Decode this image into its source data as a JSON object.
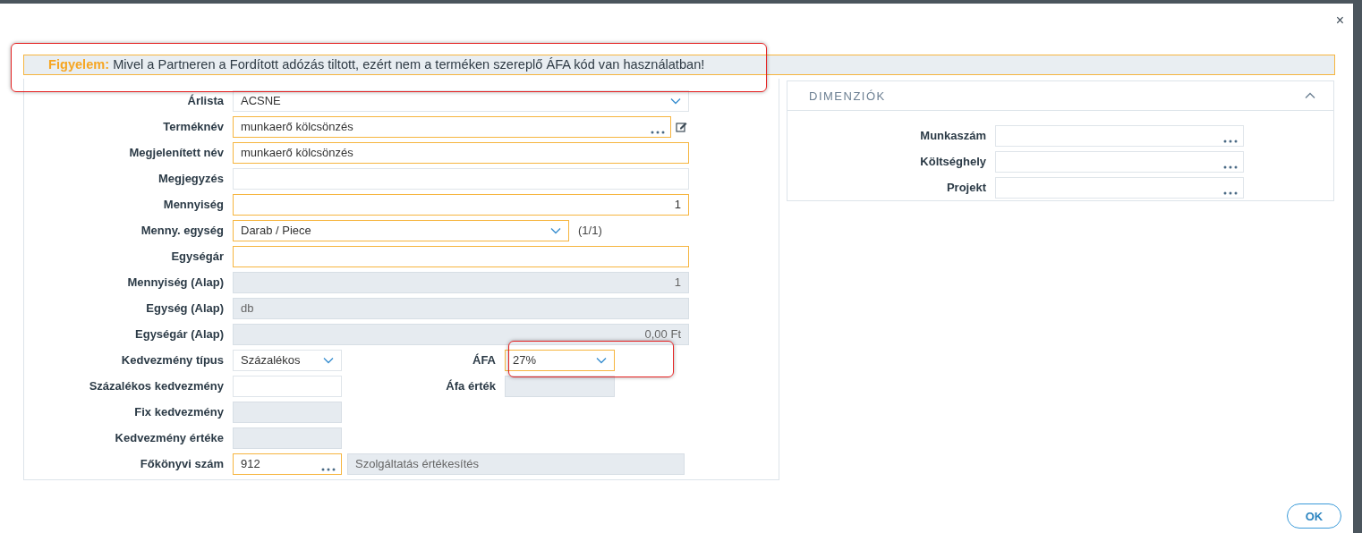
{
  "dialog": {
    "close": "×"
  },
  "notice": {
    "label": "Figyelem:",
    "text": "Mivel a Partneren a Fordított adózás tiltott, ezért nem a terméken szereplő ÁFA kód van használatban!"
  },
  "form": {
    "rows": [
      {
        "label": "Árlista",
        "field": {
          "kind": "select",
          "value": "ACSNE",
          "required": false,
          "disabled": false
        }
      },
      {
        "label": "Terméknév",
        "field": {
          "kind": "lookup",
          "value": "munkaerő kölcsönzés",
          "required": true,
          "disabled": false
        },
        "edit": true
      },
      {
        "label": "Megjelenített név",
        "field": {
          "kind": "text",
          "value": "munkaerő kölcsönzés",
          "required": true,
          "disabled": false
        }
      },
      {
        "label": "Megjegyzés",
        "field": {
          "kind": "text",
          "required": false,
          "disabled": false
        }
      },
      {
        "label": "Mennyiség",
        "field": {
          "kind": "number",
          "value": "1",
          "required": true,
          "disabled": false
        }
      },
      {
        "label": "Menny. egység",
        "field": {
          "kind": "select",
          "value": "Darab / Piece",
          "required": true,
          "disabled": false
        },
        "suffix": "(1/1)"
      },
      {
        "label": "Egységár",
        "field": {
          "kind": "number",
          "required": true,
          "disabled": false
        }
      },
      {
        "label": "Mennyiség (Alap)",
        "field": {
          "kind": "number",
          "value": "1",
          "required": false,
          "disabled": true
        }
      },
      {
        "label": "Egység (Alap)",
        "field": {
          "kind": "text",
          "value": "db",
          "required": false,
          "disabled": true
        }
      },
      {
        "label": "Egységár (Alap)",
        "field": {
          "kind": "number",
          "value": "0,00 Ft",
          "required": false,
          "disabled": true
        }
      },
      {
        "label": "Kedvezmény típus",
        "field": {
          "kind": "select",
          "value": "Százalékos",
          "required": false,
          "disabled": false
        },
        "second": {
          "label": "ÁFA",
          "field": {
            "kind": "select",
            "value": "27%",
            "required": true,
            "disabled": false
          }
        }
      },
      {
        "label": "Százalékos kedvezmény",
        "field": {
          "kind": "text",
          "required": false,
          "disabled": false
        },
        "second": {
          "label": "Áfa érték",
          "field": {
            "kind": "text",
            "required": false,
            "disabled": true
          }
        }
      },
      {
        "label": "Fix kedvezmény",
        "field": {
          "kind": "text",
          "required": false,
          "disabled": true
        }
      },
      {
        "label": "Kedvezmény értéke",
        "field": {
          "kind": "text",
          "required": false,
          "disabled": true
        }
      },
      {
        "label": "Főkönyvi szám",
        "field": {
          "kind": "lookup",
          "value": "912",
          "required": true,
          "disabled": false
        },
        "description": {
          "kind": "text",
          "value": "Szolgáltatás értékesítés",
          "required": false,
          "disabled": true
        }
      }
    ]
  },
  "dimensions": {
    "title": "DIMENZIÓK",
    "expanded": true,
    "rows": [
      {
        "label": "Munkaszám",
        "field": {
          "kind": "lookup",
          "required": false,
          "disabled": false
        }
      },
      {
        "label": "Költséghely",
        "field": {
          "kind": "lookup",
          "required": false,
          "disabled": false
        }
      },
      {
        "label": "Projekt",
        "field": {
          "kind": "lookup",
          "required": false,
          "disabled": false
        }
      }
    ]
  },
  "buttons": [
    {
      "label": "OK"
    }
  ]
}
